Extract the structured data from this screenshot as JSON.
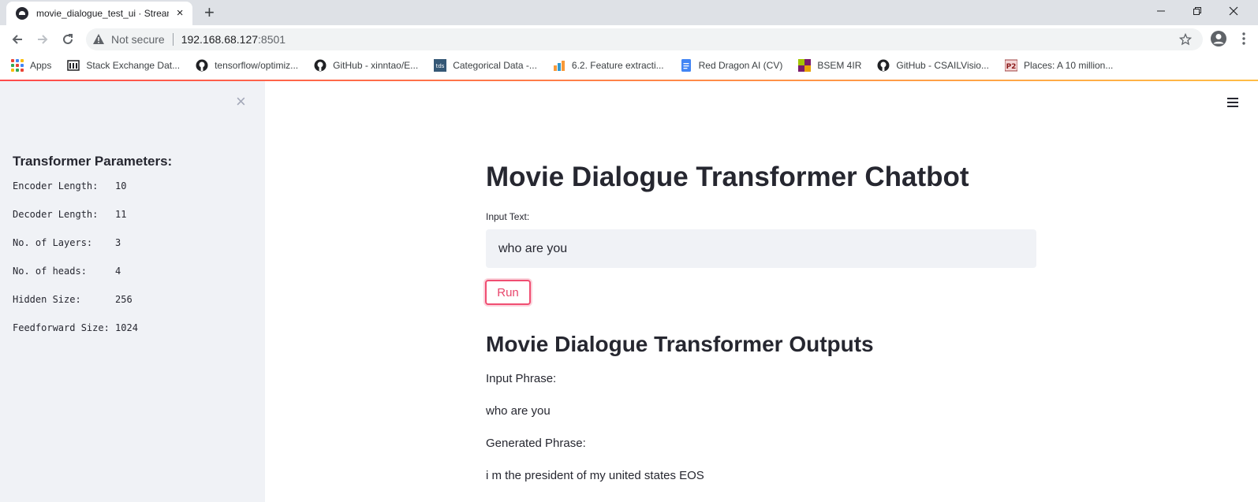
{
  "browser": {
    "tab_title": "movie_dialogue_test_ui · Streamlit",
    "new_tab_symbol": "+",
    "close_symbol": "×",
    "security_label": "Not secure",
    "url_host": "192.168.68.127",
    "url_port": ":8501",
    "bookmarks": [
      {
        "label": "Apps",
        "icon": "apps-grid-icon"
      },
      {
        "label": "Stack Exchange Dat...",
        "icon": "stack-exchange-icon"
      },
      {
        "label": "tensorflow/optimiz...",
        "icon": "github-icon"
      },
      {
        "label": "GitHub - xinntao/E...",
        "icon": "github-icon"
      },
      {
        "label": "Categorical Data -...",
        "icon": "tds-icon"
      },
      {
        "label": "6.2. Feature extracti...",
        "icon": "scikit-icon"
      },
      {
        "label": "Red Dragon AI (CV)",
        "icon": "google-docs-icon"
      },
      {
        "label": "BSEM 4IR",
        "icon": "bsem-icon"
      },
      {
        "label": "GitHub - CSAILVisio...",
        "icon": "github-icon"
      },
      {
        "label": "Places: A 10 million...",
        "icon": "places-icon"
      }
    ]
  },
  "sidebar": {
    "close_symbol": "×",
    "title": "Transformer Parameters:",
    "params": [
      "Encoder Length:   10",
      "Decoder Length:   11",
      "No. of Layers:    3",
      "No. of heads:     4",
      "Hidden Size:      256",
      "Feedforward Size: 1024"
    ]
  },
  "main": {
    "title": "Movie Dialogue Transformer Chatbot",
    "input_label": "Input Text:",
    "input_value": "who are you",
    "run_label": "Run",
    "outputs_heading": "Movie Dialogue Transformer Outputs",
    "input_phrase_label": "Input Phrase:",
    "input_phrase": "who are you",
    "generated_phrase_label": "Generated Phrase:",
    "generated_phrase": "i m the president of my united states EOS"
  },
  "colors": {
    "accent": "#ff4b4b",
    "button_border": "#f04e72",
    "sidebar_bg": "#f0f2f6",
    "text": "#262730"
  }
}
